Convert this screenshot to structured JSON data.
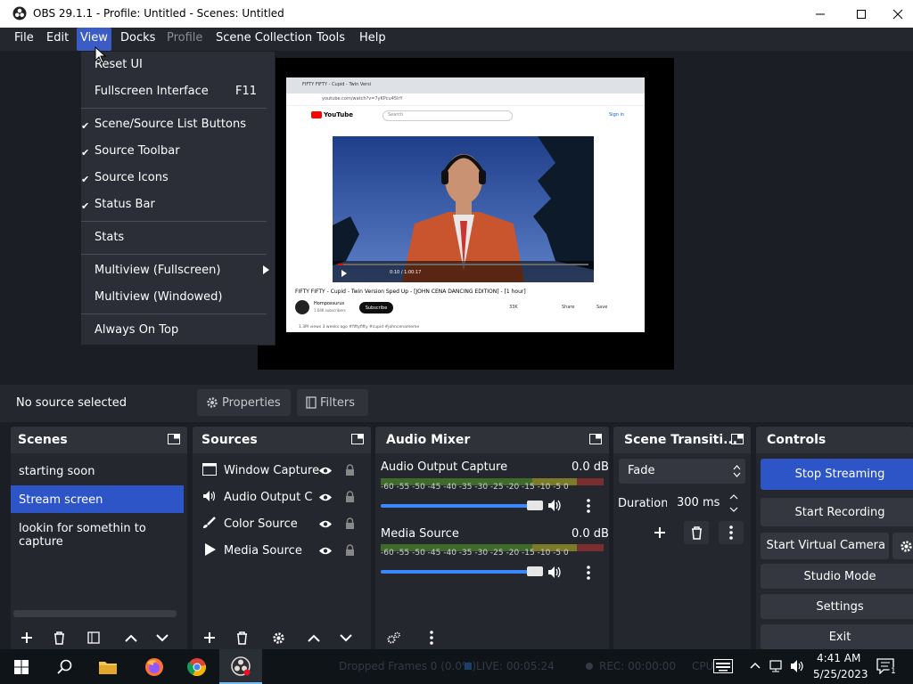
{
  "window": {
    "title": "OBS 29.1.1 - Profile: Untitled - Scenes: Untitled"
  },
  "menubar": {
    "items": [
      "File",
      "Edit",
      "View",
      "Docks",
      "Profile",
      "Scene Collection",
      "Tools",
      "Help"
    ]
  },
  "view_menu": {
    "reset_ui": "Reset UI",
    "fullscreen": "Fullscreen Interface",
    "fullscreen_shortcut": "F11",
    "scene_source_buttons": "Scene/Source List Buttons",
    "source_toolbar": "Source Toolbar",
    "source_icons": "Source Icons",
    "status_bar": "Status Bar",
    "stats": "Stats",
    "multiview_full": "Multiview (Fullscreen)",
    "multiview_window": "Multiview (Windowed)",
    "always_on_top": "Always On Top"
  },
  "preview": {
    "browser_tab": "FIFTY FIFTY - Cupid - Twin Versi",
    "url": "youtube.com/watch?v=7yKPcu45lrY",
    "youtube_logo": "YouTube",
    "search_placeholder": "Search",
    "sign_in": "Sign in",
    "video_time": "0:10 / 1:00:17",
    "video_title": "FIFTY FIFTY - Cupid - Twin Version Sped Up - [JOHN CENA DANCING EDITION] - [1 hour]",
    "channel": "Hompossurus",
    "subscribers": "1.64K subscribers",
    "subscribe": "Subscribe",
    "likes": "33K",
    "share": "Share",
    "save": "Save",
    "meta": "1.3M views  3 weeks ago  #fiftyfifty #cupid #johncenameme"
  },
  "status": {
    "no_source": "No source selected",
    "properties": "Properties",
    "filters": "Filters"
  },
  "scenes": {
    "title": "Scenes",
    "items": [
      "starting soon",
      "Stream screen",
      "lookin for somethin to capture"
    ]
  },
  "sources": {
    "title": "Sources",
    "items": [
      "Window Capture",
      "Audio Output Ca",
      "Color Source",
      "Media Source"
    ]
  },
  "mixer": {
    "title": "Audio Mixer",
    "tracks": [
      {
        "name": "Audio Output Capture",
        "db": "0.0 dB",
        "volume": 1.0
      },
      {
        "name": "Media Source",
        "db": "0.0 dB",
        "volume": 1.0
      }
    ],
    "scale": "-60 -55 -50 -45 -40 -35 -30 -25 -20 -15 -10 -5 0"
  },
  "transitions": {
    "title": "Scene Transiti...",
    "type": "Fade",
    "duration_label": "Duration",
    "duration_value": "300 ms"
  },
  "controls": {
    "title": "Controls",
    "stop_streaming": "Stop Streaming",
    "start_recording": "Start Recording",
    "start_virtual_camera": "Start Virtual Camera",
    "studio_mode": "Studio Mode",
    "settings": "Settings",
    "exit": "Exit"
  },
  "statusbar": {
    "dropped": "Dropped Frames 0 (0.0%)",
    "live": "LIVE: 00:05:24",
    "rec": "REC: 00:00:00",
    "cpu": "CPU"
  },
  "taskbar": {
    "time": "4:41 AM",
    "date": "5/25/2023",
    "notification_count": "1"
  },
  "colors": {
    "accent_blue": "#2d55c8",
    "panel_bg": "#25272f",
    "dock_header": "#2f3239",
    "window_bg": "#1c1e25"
  }
}
